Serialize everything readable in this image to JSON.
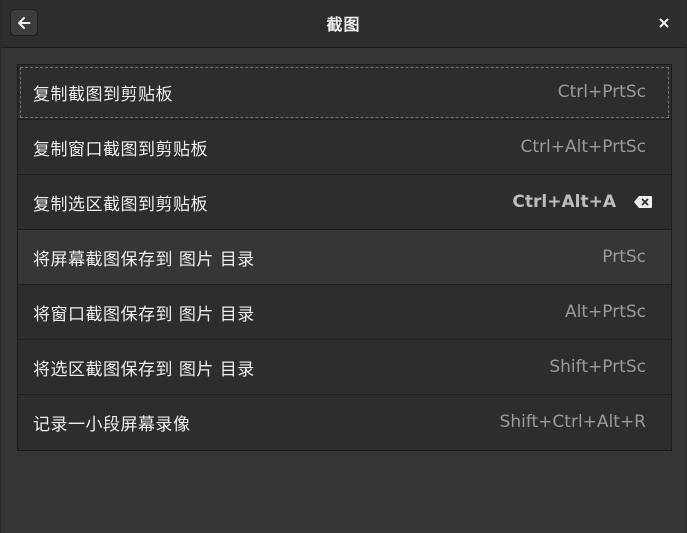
{
  "header": {
    "title": "截图",
    "back_icon": "left-arrow-icon",
    "close_icon": "close-icon"
  },
  "shortcuts": [
    {
      "label": "复制截图到剪贴板",
      "accel": "Ctrl+PrtSc"
    },
    {
      "label": "复制窗口截图到剪贴板",
      "accel": "Ctrl+Alt+PrtSc"
    },
    {
      "label": "复制选区截图到剪贴板",
      "accel": "Ctrl+Alt+A",
      "editing": true,
      "clear_icon": "backspace-clear-icon"
    },
    {
      "label": "将屏幕截图保存到 图片 目录",
      "accel": "PrtSc"
    },
    {
      "label": "将窗口截图保存到 图片 目录",
      "accel": "Alt+PrtSc"
    },
    {
      "label": "将选区截图保存到 图片 目录",
      "accel": "Shift+PrtSc"
    },
    {
      "label": "记录一小段屏幕录像",
      "accel": "Shift+Ctrl+Alt+R"
    }
  ],
  "colors": {
    "window_bg": "#353535",
    "header_bg": "#2d2d2d",
    "row_bg": "#2d2d2d",
    "text": "#eeeeec",
    "accel_text": "#9a9a98"
  }
}
